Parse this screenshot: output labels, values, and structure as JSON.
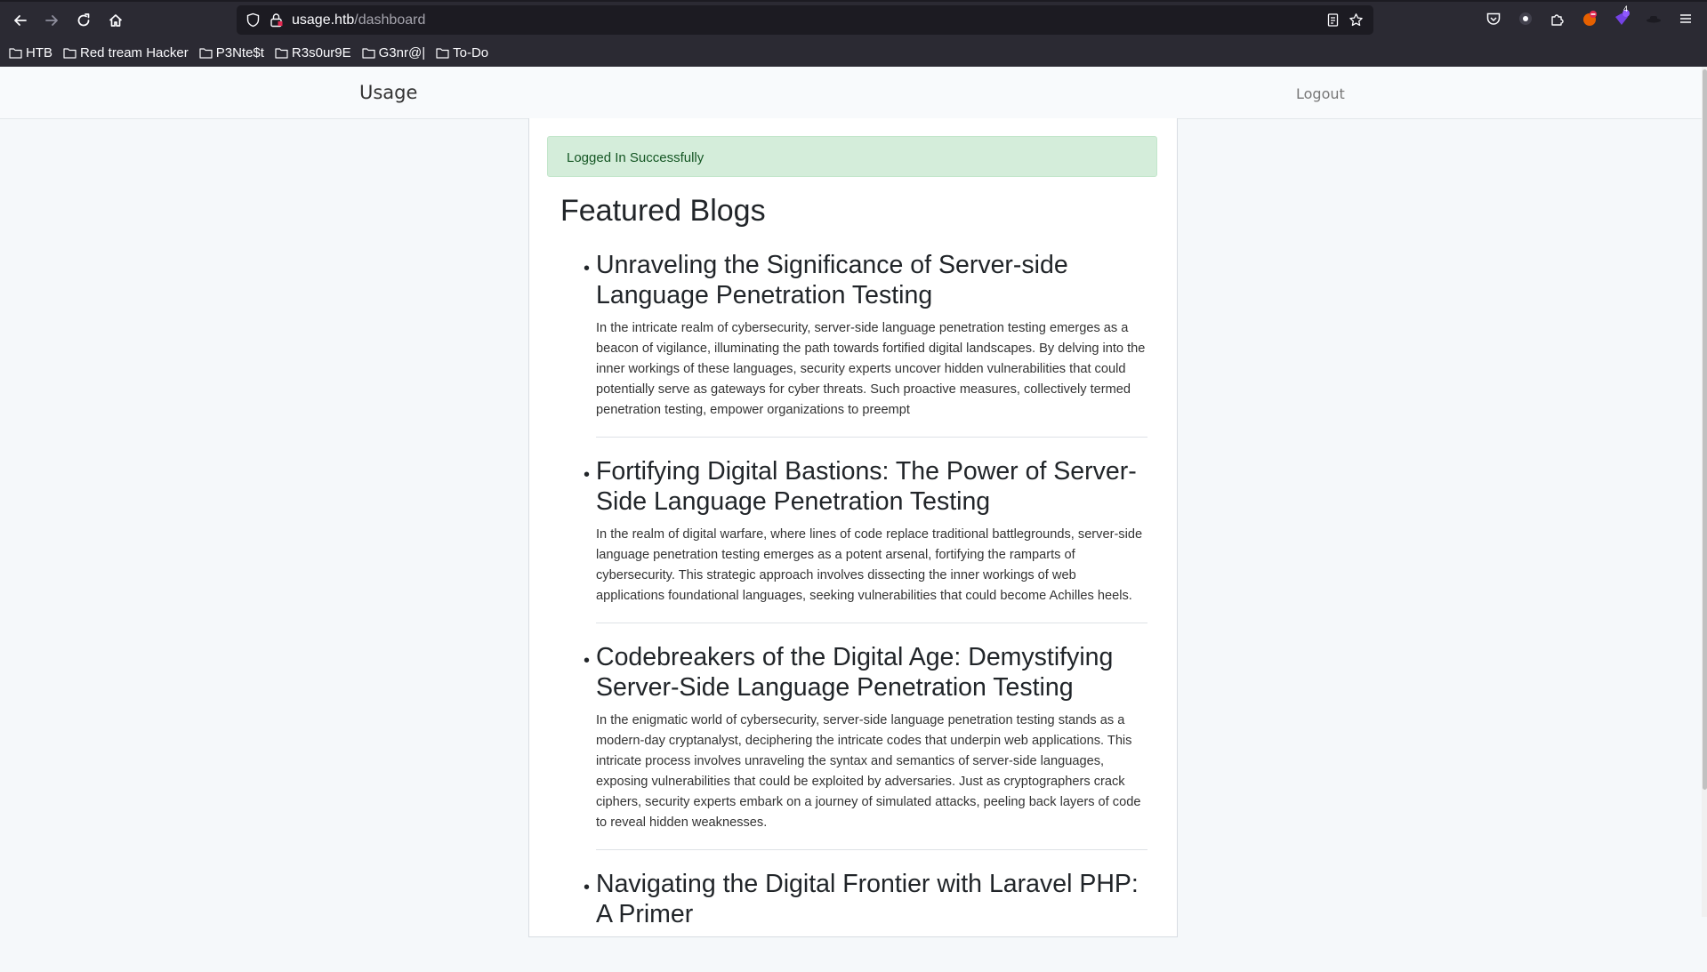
{
  "browser": {
    "url_host": "usage.htb",
    "url_path": "/dashboard",
    "bookmarks": [
      "HTB",
      "Red tream Hacker",
      "P3Nte$t",
      "R3s0ur9E",
      "G3nr@|",
      "To-Do"
    ],
    "extension_badge": "4"
  },
  "nav": {
    "brand": "Usage",
    "logout": "Logout"
  },
  "alert": {
    "text": "Logged In Successfully"
  },
  "main": {
    "heading": "Featured Blogs",
    "posts": [
      {
        "title": "Unraveling the Significance of Server-side Language Penetration Testing",
        "body": "In the intricate realm of cybersecurity, server-side language penetration testing emerges as a beacon of vigilance, illuminating the path towards fortified digital landscapes. By delving into the inner workings of these languages, security experts uncover hidden vulnerabilities that could potentially serve as gateways for cyber threats. Such proactive measures, collectively termed penetration testing, empower organizations to preempt"
      },
      {
        "title": "Fortifying Digital Bastions: The Power of Server-Side Language Penetration Testing",
        "body": "In the realm of digital warfare, where lines of code replace traditional battlegrounds, server-side language penetration testing emerges as a potent arsenal, fortifying the ramparts of cybersecurity. This strategic approach involves dissecting the inner workings of web applications foundational languages, seeking vulnerabilities that could become Achilles heels."
      },
      {
        "title": "Codebreakers of the Digital Age: Demystifying Server-Side Language Penetration Testing",
        "body": "In the enigmatic world of cybersecurity, server-side language penetration testing stands as a modern-day cryptanalyst, deciphering the intricate codes that underpin web applications. This intricate process involves unraveling the syntax and semantics of server-side languages, exposing vulnerabilities that could be exploited by adversaries. Just as cryptographers crack ciphers, security experts embark on a journey of simulated attacks, peeling back layers of code to reveal hidden weaknesses."
      },
      {
        "title": "Navigating the Digital Frontier with Laravel PHP: A Primer",
        "body": ""
      }
    ]
  },
  "colors": {
    "chrome_bg": "#2b2a33",
    "urlbar_bg": "#1c1b22",
    "alert_bg": "#d4edda",
    "alert_text": "#155724",
    "page_bg": "#f5f8fa"
  }
}
